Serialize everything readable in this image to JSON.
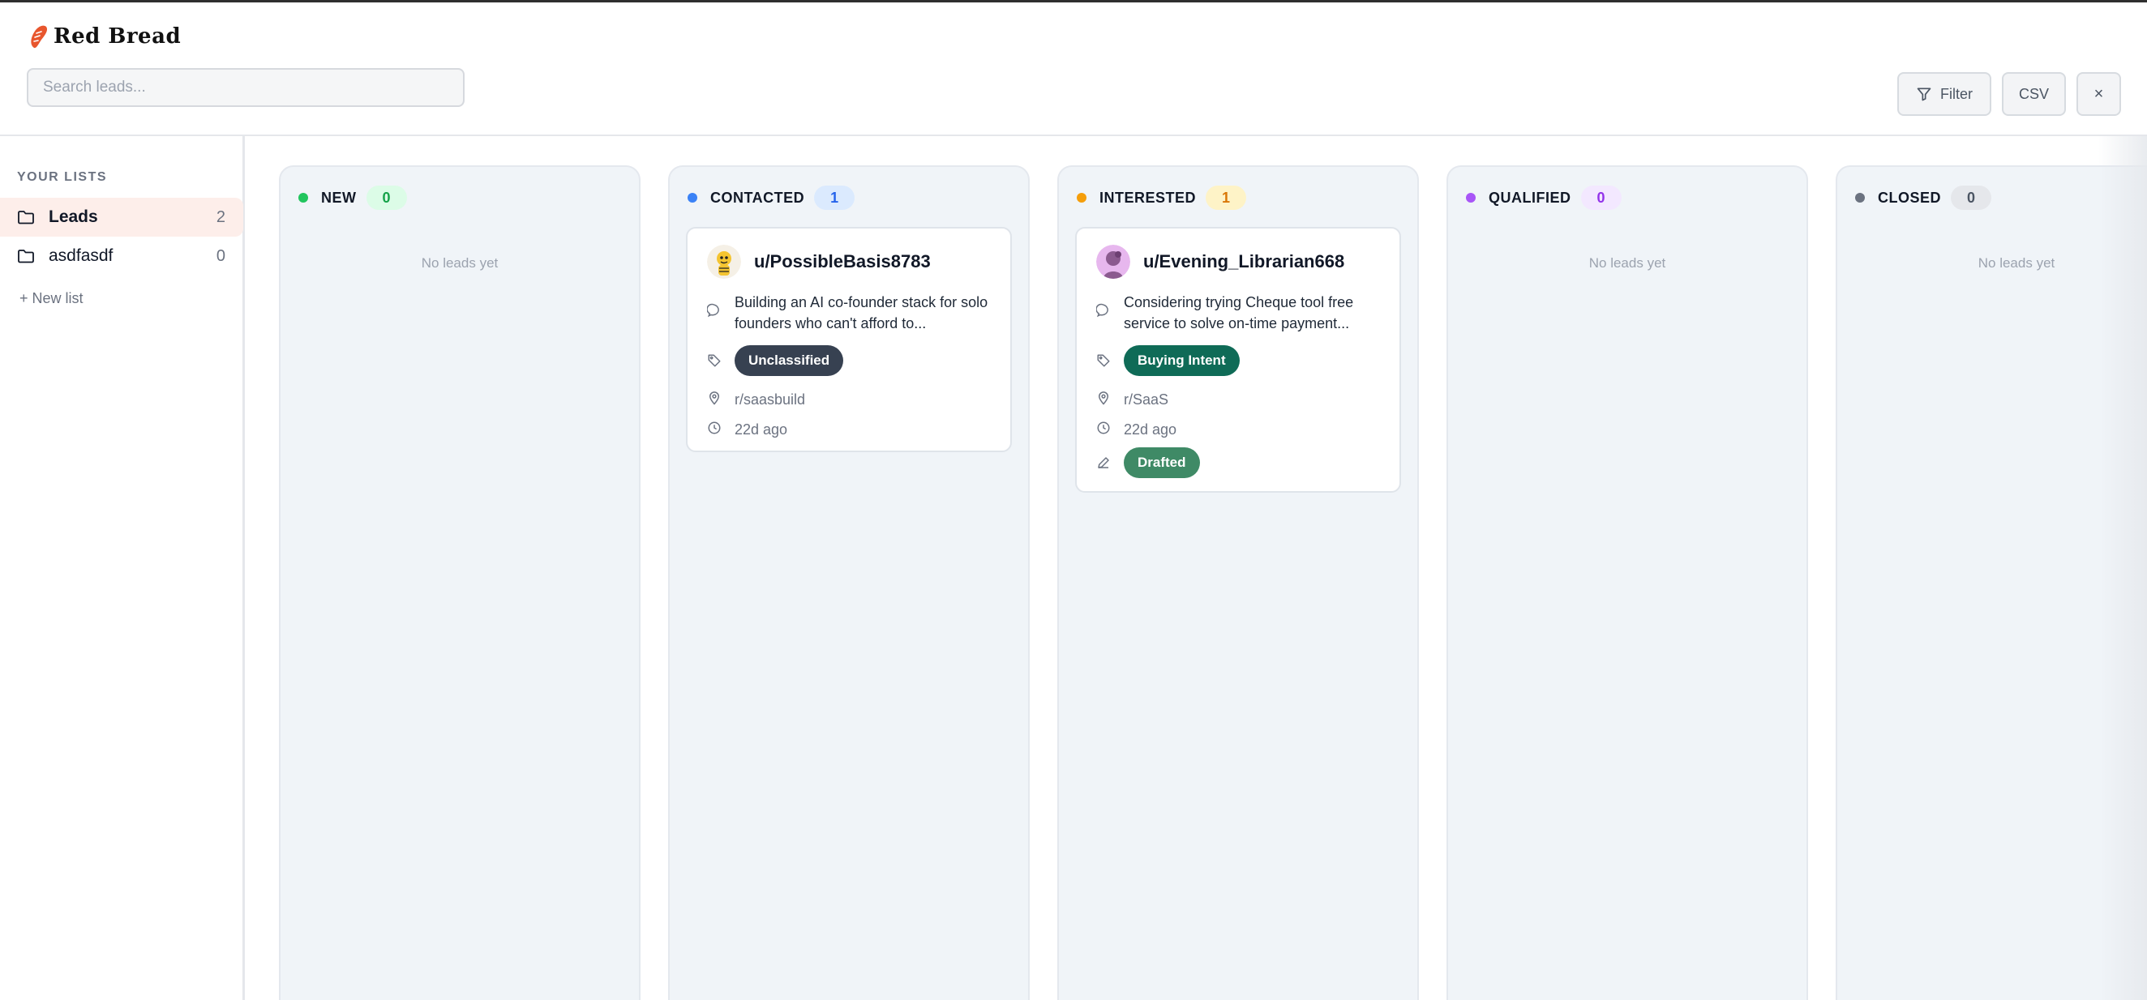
{
  "app": {
    "name": "Red Bread"
  },
  "header": {
    "search_placeholder": "Search leads...",
    "filter_label": "Filter",
    "csv_label": "CSV",
    "close_label": "×"
  },
  "sidebar": {
    "title": "YOUR LISTS",
    "items": [
      {
        "label": "Leads",
        "count": "2"
      },
      {
        "label": "asdfasdf",
        "count": "0"
      }
    ],
    "new_list_label": "+ New list"
  },
  "columns": [
    {
      "title": "NEW",
      "count": "0",
      "empty_text": "No leads yet",
      "dot": "#22c55e",
      "badge_bg": "#dcfce7",
      "badge_fg": "#16a34a"
    },
    {
      "title": "CONTACTED",
      "count": "1",
      "dot": "#3b82f6",
      "badge_bg": "#dbeafe",
      "badge_fg": "#2563eb",
      "card": {
        "username": "u/PossibleBasis8783",
        "description": "Building an AI co-founder stack for solo founders who can't afford to...",
        "tag": "Unclassified",
        "subreddit": "r/saasbuild",
        "time": "22d ago"
      }
    },
    {
      "title": "INTERESTED",
      "count": "1",
      "dot": "#f59e0b",
      "badge_bg": "#fef3c7",
      "badge_fg": "#d97706",
      "card": {
        "username": "u/Evening_Librarian668",
        "description": "Considering trying Cheque tool free service to solve on-time payment...",
        "tag": "Buying Intent",
        "subreddit": "r/SaaS",
        "time": "22d ago",
        "status": "Drafted"
      }
    },
    {
      "title": "QUALIFIED",
      "count": "0",
      "empty_text": "No leads yet",
      "dot": "#a855f7",
      "badge_bg": "#f3e8ff",
      "badge_fg": "#9333ea"
    },
    {
      "title": "CLOSED",
      "count": "0",
      "empty_text": "No leads yet",
      "dot": "#6b7280",
      "badge_bg": "#e5e7eb",
      "badge_fg": "#4b5563"
    }
  ],
  "colors": {
    "brand": "#e8562d",
    "tag_unclassified": "#374151",
    "tag_buying_intent": "#0f6b57",
    "status_drafted": "#3f8a66"
  },
  "icons": {
    "comment": "comment-icon",
    "tag": "tag-icon",
    "location": "location-pin-icon",
    "time": "clock-icon",
    "status": "pencil-icon",
    "list": "folder-icon",
    "filter": "filter-icon"
  }
}
